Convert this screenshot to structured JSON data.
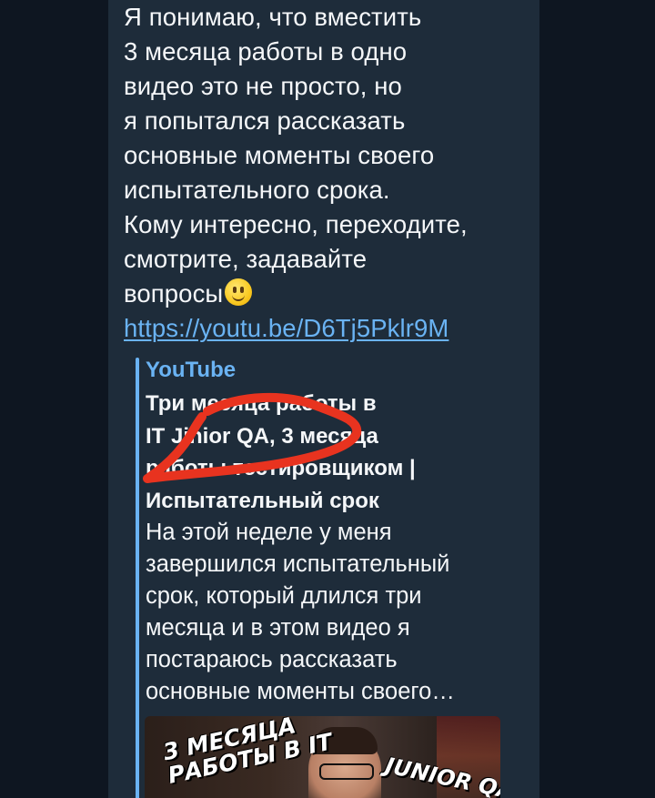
{
  "message": {
    "lines": [
      "Я понимаю, что вместить",
      "3 месяца работы в одно",
      "видео это не просто, но",
      "я попытался рассказать",
      "основные моменты своего",
      "испытательного срока.",
      "Кому интересно, переходите,",
      "смотрите, задавайте",
      "вопросы"
    ],
    "emoji": "slightly-smiling-face",
    "link": "https://youtu.be/D6Tj5Pklr9M"
  },
  "preview": {
    "site_name": "YouTube",
    "title_lines": [
      "Три месяца работы в",
      "IT  Jinior QA,  3 месяца",
      "работы тестировщиком |",
      "Испытательный срок"
    ],
    "description_lines": [
      "На этой неделе у меня",
      "завершился испытательный",
      "срок, который длился три",
      "месяца и в этом видео я",
      "постараюсь рассказать",
      "основные моменты своего…"
    ],
    "thumbnail": {
      "text_left_lines": [
        "3 МЕСЯЦА",
        "РАБОТЫ В IT"
      ],
      "text_right": "JUNIOR QA"
    }
  },
  "colors": {
    "background": "#0e1621",
    "bubble": "#1e2c3a",
    "link": "#6ab3f3",
    "text": "#f5f7f9",
    "annotation": "#e8331f"
  }
}
